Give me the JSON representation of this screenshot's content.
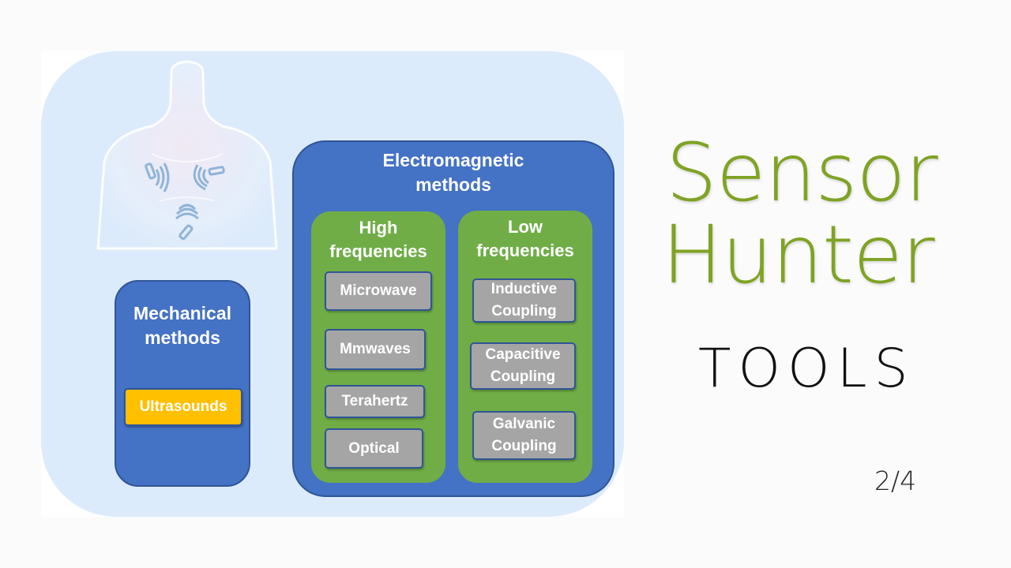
{
  "slide": {
    "title_line1": "Sensor",
    "title_line2": "Hunter",
    "subtitle": "TOOLS",
    "page_indicator": "2/4",
    "title_color": "#7fa324"
  },
  "diagram": {
    "illustration": "human-torso-with-wearable-sensors",
    "mechanical": {
      "heading": "Mechanical methods",
      "heading_line1": "Mechanical",
      "heading_line2": "methods",
      "items": [
        "Ultrasounds"
      ]
    },
    "electromagnetic": {
      "heading_line1": "Electromagnetic",
      "heading_line2": "methods",
      "high": {
        "heading_line1": "High",
        "heading_line2": "frequencies",
        "items": [
          "Microwave",
          "Mmwaves",
          "Terahertz",
          "Optical"
        ]
      },
      "low": {
        "heading_line1": "Low",
        "heading_line2": "frequencies",
        "items": [
          {
            "line1": "Inductive",
            "line2": "Coupling"
          },
          {
            "line1": "Capacitive",
            "line2": "Coupling"
          },
          {
            "line1": "Galvanic",
            "line2": "Coupling"
          }
        ]
      }
    },
    "colors": {
      "panel": "#dcebfb",
      "method_box": "#4472c4",
      "frequency_box": "#70ad47",
      "item_chip": "#a5a5a5",
      "ultrasound_chip": "#ffc000"
    }
  }
}
